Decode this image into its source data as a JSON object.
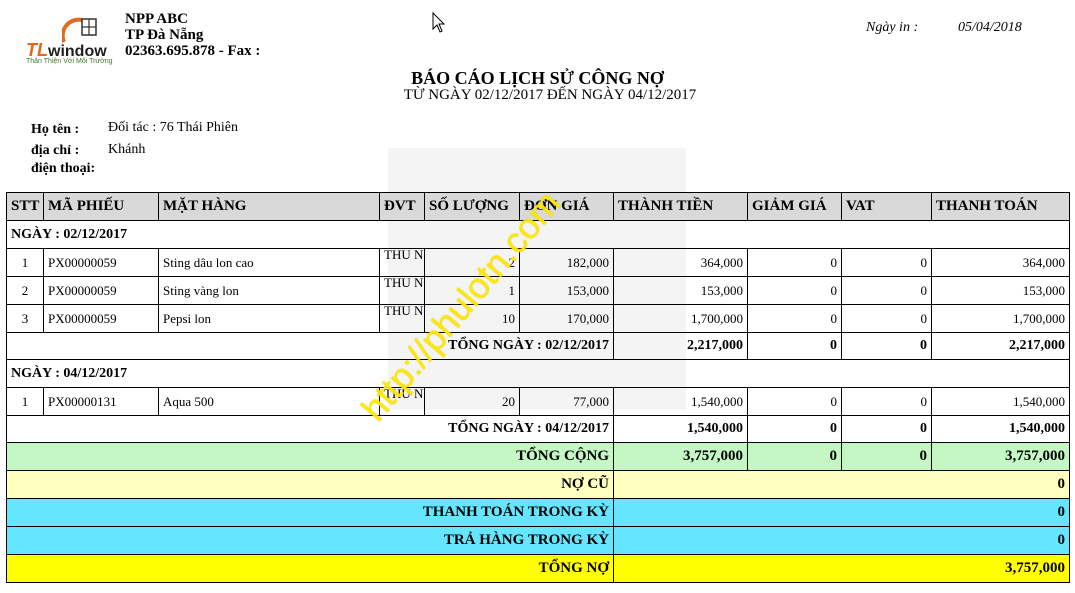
{
  "logo": {
    "tl": "TL",
    "window": "window",
    "slogan": "Thân Thiện Với Môi Trường"
  },
  "company": {
    "name": "NPP ABC",
    "city": "TP Đà Nẵng",
    "contact": "02363.695.878 - Fax :"
  },
  "print": {
    "label": "Ngày in :",
    "date": "05/04/2018"
  },
  "report": {
    "title": "BÁO CÁO LỊCH SỬ CÔNG NỢ",
    "subtitle": "TỪ NGÀY 02/12/2017 ĐẾN NGÀY 04/12/2017"
  },
  "customer": {
    "name_label": "Họ tên :",
    "name": "Đối tác : 76 Thái Phiên",
    "address_label": "địa chỉ :",
    "address": "Khánh",
    "phone_label": "điện thoại:"
  },
  "watermark": "http://phulotn.com",
  "table": {
    "headers": [
      "STT",
      "MÃ PHIẾU",
      "MẶT HÀNG",
      "ĐVT",
      "SỐ LƯỢNG",
      "ĐƠN GIÁ",
      "THÀNH TIỀN",
      "GIẢM GIÁ",
      "VAT",
      "THANH TOÁN"
    ],
    "groups": [
      {
        "label": "NGÀY : 02/12/2017",
        "rows": [
          {
            "stt": "1",
            "code": "PX00000059",
            "item": "Sting dâu lon cao",
            "unit": "THU NG",
            "qty": "2",
            "price": "182,000",
            "amount": "364,000",
            "discount": "0",
            "vat": "0",
            "pay": "364,000"
          },
          {
            "stt": "2",
            "code": "PX00000059",
            "item": "Sting vàng lon",
            "unit": "THU NG",
            "qty": "1",
            "price": "153,000",
            "amount": "153,000",
            "discount": "0",
            "vat": "0",
            "pay": "153,000"
          },
          {
            "stt": "3",
            "code": "PX00000059",
            "item": "Pepsi lon",
            "unit": "THU NG",
            "qty": "10",
            "price": "170,000",
            "amount": "1,700,000",
            "discount": "0",
            "vat": "0",
            "pay": "1,700,000"
          }
        ],
        "subtotal": {
          "label": "TỔNG NGÀY : 02/12/2017",
          "amount": "2,217,000",
          "discount": "0",
          "vat": "0",
          "pay": "2,217,000"
        }
      },
      {
        "label": "NGÀY : 04/12/2017",
        "rows": [
          {
            "stt": "1",
            "code": "PX00000131",
            "item": "Aqua 500",
            "unit": "THU NG",
            "qty": "20",
            "price": "77,000",
            "amount": "1,540,000",
            "discount": "0",
            "vat": "0",
            "pay": "1,540,000"
          }
        ],
        "subtotal": {
          "label": "TỔNG NGÀY : 04/12/2017",
          "amount": "1,540,000",
          "discount": "0",
          "vat": "0",
          "pay": "1,540,000"
        }
      }
    ],
    "grand_total": {
      "label": "TỔNG CỘNG",
      "amount": "3,757,000",
      "discount": "0",
      "vat": "0",
      "pay": "3,757,000"
    },
    "summary": [
      {
        "key": "nocu",
        "label": "NỢ CŨ",
        "value": "0"
      },
      {
        "key": "tt",
        "label": "THANH TOÁN TRONG KỲ",
        "value": "0"
      },
      {
        "key": "tt",
        "label": "TRẢ HÀNG TRONG KỲ",
        "value": "0"
      },
      {
        "key": "tn",
        "label": "TỔNG NỢ",
        "value": "3,757,000"
      }
    ]
  }
}
